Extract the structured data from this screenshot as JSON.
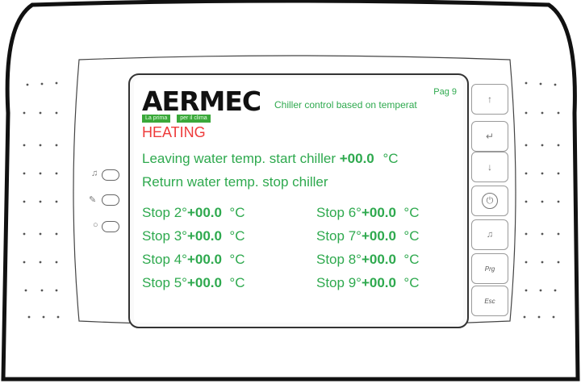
{
  "logo": {
    "brand": "AERMEC",
    "tagline_left": "La prima",
    "tagline_right": "per il clima"
  },
  "header": {
    "page": "Pag 9",
    "subtitle": "Chiller control based on temperat"
  },
  "mode": {
    "label": "HEATING",
    "color": "#ee3b3b"
  },
  "rows": [
    {
      "label": "Leaving water temp. start chiller",
      "value": "+00.0",
      "unit": "°C"
    },
    {
      "label": "Return water temp. stop chiller"
    }
  ],
  "stops": [
    {
      "label": "Stop 2°",
      "value": "+00.0",
      "unit": "°C"
    },
    {
      "label": "Stop 3°",
      "value": "+00.0",
      "unit": "°C"
    },
    {
      "label": "Stop 4°",
      "value": "+00.0",
      "unit": "°C"
    },
    {
      "label": "Stop 5°",
      "value": "+00.0",
      "unit": "°C"
    },
    {
      "label": "Stop 6°",
      "value": "+00.0",
      "unit": "°C"
    },
    {
      "label": "Stop 7°",
      "value": "+00.0",
      "unit": "°C"
    },
    {
      "label": "Stop 8°",
      "value": "+00.0",
      "unit": "°C"
    },
    {
      "label": "Stop 9°",
      "value": "+00.0",
      "unit": "°C"
    }
  ],
  "keys": [
    {
      "icon": "up-arrow-icon",
      "glyph": "↑"
    },
    {
      "icon": "enter-icon",
      "glyph": "↵"
    },
    {
      "icon": "down-arrow-icon",
      "glyph": "↓"
    },
    {
      "icon": "power-icon",
      "glyph": "⏻"
    },
    {
      "icon": "alarm-bell-icon",
      "glyph": "🔔"
    },
    {
      "label": "Prg"
    },
    {
      "label": "Esc"
    }
  ],
  "leds": [
    {
      "icon": "alarm-bell-icon"
    },
    {
      "icon": "wrench-icon"
    },
    {
      "icon": "circle-icon"
    }
  ],
  "colors": {
    "text_green": "#2ea94e",
    "alarm_red": "#ee3b3b",
    "bezel": "#111111"
  }
}
